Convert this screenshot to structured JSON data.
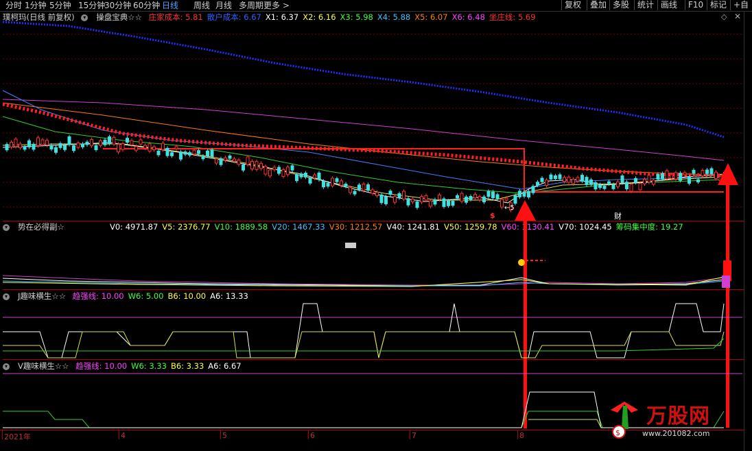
{
  "toolbar": {
    "periods": [
      "分时",
      "1分钟",
      "5分钟",
      "15分钟",
      "30分钟",
      "60分钟",
      "日线",
      "周线",
      "月线",
      "多周期",
      "更多 >"
    ],
    "active_period": "日线",
    "buttons": [
      "复权",
      "叠加",
      "多股",
      "统计",
      "画线",
      "F10",
      "标记",
      "+自"
    ]
  },
  "main_panel": {
    "stock_title": "璞柯玛(日线 前复权)",
    "indicator_name": "操盘宝典☆☆",
    "values": [
      {
        "label": "庄家成本:",
        "value": "5.81",
        "color": "#ff3030"
      },
      {
        "label": "散户成本:",
        "value": "6.67",
        "color": "#3060ff"
      },
      {
        "label": "X1:",
        "value": "6.37",
        "color": "#ffffff"
      },
      {
        "label": "X2:",
        "value": "6.16",
        "color": "#ffff40"
      },
      {
        "label": "X3:",
        "value": "5.98",
        "color": "#40ff40"
      },
      {
        "label": "X4:",
        "value": "5.88",
        "color": "#40c0ff"
      },
      {
        "label": "X5:",
        "value": "6.07",
        "color": "#ff8000"
      },
      {
        "label": "X6:",
        "value": "6.48",
        "color": "#ff40ff"
      },
      {
        "label": "坐庄线:",
        "value": "5.69",
        "color": "#ff3030"
      }
    ],
    "marker_arrow": "←5",
    "marker_dollar": "$",
    "marker_cai": "财"
  },
  "volume_panel": {
    "title": "势在必得副☆",
    "values": [
      {
        "label": "V0:",
        "value": "4971.87",
        "color": "#ffffff"
      },
      {
        "label": "V5:",
        "value": "2376.77",
        "color": "#ffff40"
      },
      {
        "label": "V10:",
        "value": "1889.58",
        "color": "#40ff40"
      },
      {
        "label": "V20:",
        "value": "1467.33",
        "color": "#40c0ff"
      },
      {
        "label": "V30:",
        "value": "1212.57",
        "color": "#ff8000"
      },
      {
        "label": "V40:",
        "value": "1241.81",
        "color": "#ffffff"
      },
      {
        "label": "V50:",
        "value": "1259.78",
        "color": "#ffff40"
      },
      {
        "label": "V60:",
        "value": "1130.41",
        "color": "#ff40ff"
      },
      {
        "label": "V70:",
        "value": "1024.45",
        "color": "#ffffff"
      },
      {
        "label": "筹码集中度:",
        "value": "19.27",
        "color": "#40ff40"
      }
    ]
  },
  "j_panel": {
    "title": "J趣味横生☆☆",
    "values": [
      {
        "label": "趋强线:",
        "value": "10.00",
        "color": "#ff40ff"
      },
      {
        "label": "W6:",
        "value": "5.00",
        "color": "#40ff40"
      },
      {
        "label": "B6:",
        "value": "10.00",
        "color": "#ffff40"
      },
      {
        "label": "A6:",
        "value": "13.33",
        "color": "#ffffff"
      }
    ]
  },
  "v_panel": {
    "title": "V趣味横生☆☆",
    "values": [
      {
        "label": "趋强线:",
        "value": "10.00",
        "color": "#ff40ff"
      },
      {
        "label": "W6:",
        "value": "3.33",
        "color": "#40ff40"
      },
      {
        "label": "B6:",
        "value": "3.33",
        "color": "#ffff40"
      },
      {
        "label": "A6:",
        "value": "6.67",
        "color": "#ffffff"
      }
    ]
  },
  "x_axis": {
    "labels": [
      "2021年",
      "4",
      "5",
      "6",
      "7",
      "8"
    ]
  },
  "logo": {
    "brand": "万股网",
    "url": "www.201082.com"
  }
}
